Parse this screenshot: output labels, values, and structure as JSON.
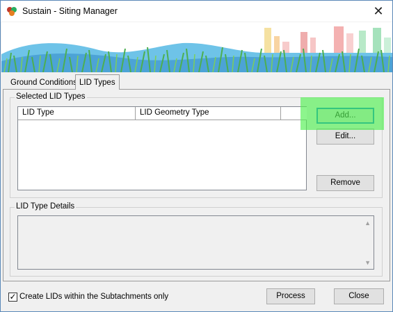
{
  "window": {
    "title": "Sustain - Siting Manager",
    "close_glyph": "✕"
  },
  "tabs": [
    {
      "label": "Ground Conditions",
      "active": false
    },
    {
      "label": "LID Types",
      "active": true
    }
  ],
  "selected_lid_types": {
    "group_label": "Selected LID Types",
    "columns": [
      "LID Type",
      "LID Geometry Type"
    ],
    "rows": []
  },
  "buttons": {
    "add": "Add...",
    "edit": "Edit...",
    "remove": "Remove",
    "process": "Process",
    "close": "Close"
  },
  "lid_type_details": {
    "group_label": "LID Type Details",
    "value": "",
    "scroll_up_glyph": "▲",
    "scroll_down_glyph": "▼"
  },
  "footer": {
    "checkbox_label": "Create LIDs within the Subtachments only",
    "checkbox_checked": true,
    "check_glyph": "✓"
  },
  "colors": {
    "window_bg": "#f0f0f0",
    "highlight": "#50f050",
    "accent": "#0078d7"
  }
}
